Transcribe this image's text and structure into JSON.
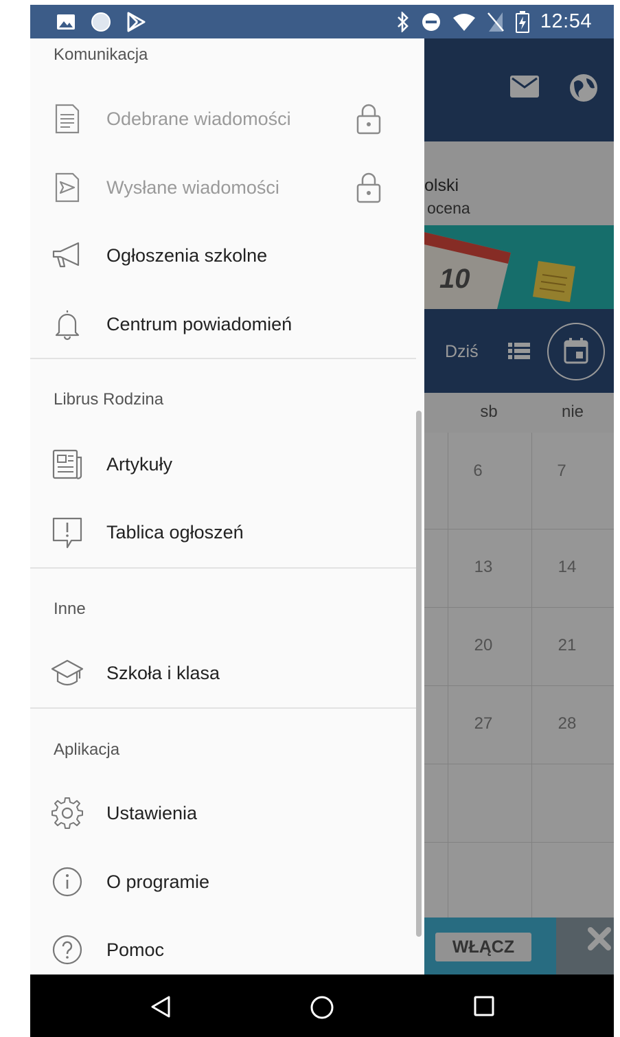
{
  "status_bar": {
    "time": "12:54",
    "left_icons": [
      "image-icon",
      "circle-app-icon",
      "play-store-icon"
    ],
    "right_icons": [
      "bluetooth-icon",
      "do-not-disturb-icon",
      "wifi-icon",
      "no-sim-icon",
      "battery-charging-icon"
    ]
  },
  "drawer": {
    "sections": [
      {
        "header": "Komunikacja",
        "items": [
          {
            "label": "Odebrane wiadomości",
            "icon": "inbox-document-icon",
            "locked": true
          },
          {
            "label": "Wysłane wiadomości",
            "icon": "sent-document-icon",
            "locked": true
          },
          {
            "label": "Ogłoszenia szkolne",
            "icon": "megaphone-icon",
            "locked": false
          },
          {
            "label": "Centrum powiadomień",
            "icon": "bell-icon",
            "locked": false
          }
        ]
      },
      {
        "header": "Librus Rodzina",
        "items": [
          {
            "label": "Artykuły",
            "icon": "newspaper-icon",
            "locked": false
          },
          {
            "label": "Tablica ogłoszeń",
            "icon": "notice-board-icon",
            "locked": false
          }
        ]
      },
      {
        "header": "Inne",
        "items": [
          {
            "label": "Szkoła i klasa",
            "icon": "graduation-cap-icon",
            "locked": false
          }
        ]
      },
      {
        "header": "Aplikacja",
        "items": [
          {
            "label": "Ustawienia",
            "icon": "gear-icon",
            "locked": false
          },
          {
            "label": "O programie",
            "icon": "info-icon",
            "locked": false
          },
          {
            "label": "Pomoc",
            "icon": "help-icon",
            "locked": false
          }
        ]
      }
    ]
  },
  "background_app": {
    "toolbar_icons": [
      "mail-icon",
      "globe-icon"
    ],
    "grade_subject": "olski",
    "grade_desc": "ocena",
    "banner_number": "10",
    "calendar": {
      "today_label": "Dziś",
      "weekdays": [
        "sb",
        "nie"
      ],
      "days": [
        [
          "6",
          "7"
        ],
        [
          "13",
          "14"
        ],
        [
          "20",
          "21"
        ],
        [
          "27",
          "28"
        ]
      ]
    },
    "promo_button": "WŁĄCZ"
  },
  "colors": {
    "status_bar": "#3c5c88",
    "toolbar": "#2e4e7c",
    "drawer_bg": "#fafafa",
    "banner": "#25b8b3",
    "promo": "#43b5d8"
  }
}
